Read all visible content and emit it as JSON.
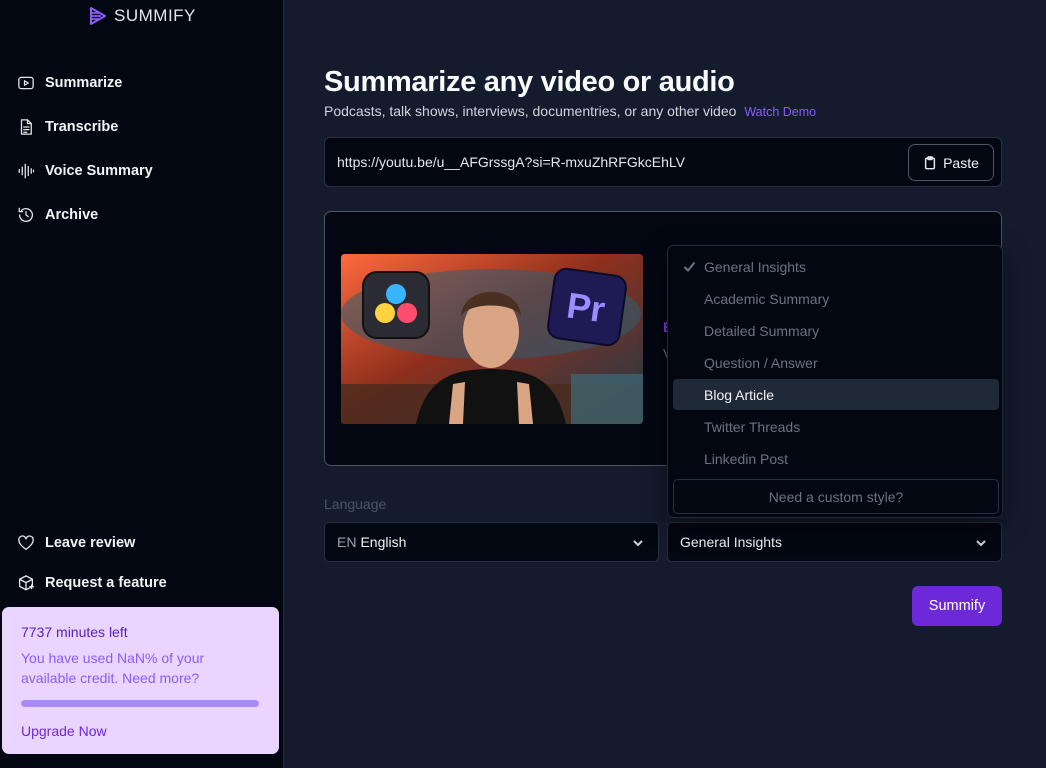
{
  "brand": {
    "name": "SUMMIFY",
    "accent": "#7c3aed"
  },
  "sidebar": {
    "nav": [
      {
        "label": "Summarize",
        "icon": "video-play-icon"
      },
      {
        "label": "Transcribe",
        "icon": "document-icon"
      },
      {
        "label": "Voice Summary",
        "icon": "waveform-icon"
      },
      {
        "label": "Archive",
        "icon": "history-icon"
      }
    ],
    "bottom": [
      {
        "label": "Leave review",
        "icon": "heart-icon"
      },
      {
        "label": "Request a feature",
        "icon": "package-icon"
      }
    ],
    "credit": {
      "minutes_left": "7737 minutes left",
      "text": "You have used NaN% of your available credit. Need more?",
      "upgrade": "Upgrade Now",
      "progress_fraction": 1.0
    }
  },
  "main": {
    "title": "Summarize any video or audio",
    "subtitle": "Podcasts, talk shows, interviews, documentries, or any other video",
    "watch_demo": "Watch Demo",
    "url_value": "https://youtu.be/u__AFGrssgA?si=R-mxuZhRFGkcEhLV",
    "paste_label": "Paste",
    "language_label": "Language",
    "language_code": "EN",
    "language_name": "English",
    "style_selected": "General Insights",
    "summify_label": "Summify",
    "thumb_icons": {
      "left": "davinci-resolve-icon",
      "right": "premiere-pro-icon",
      "right_text": "Pr"
    }
  },
  "dropdown": {
    "options": [
      {
        "label": "General Insights",
        "checked": true
      },
      {
        "label": "Academic Summary"
      },
      {
        "label": "Detailed Summary"
      },
      {
        "label": "Question / Answer"
      },
      {
        "label": "Blog Article",
        "highlighted": true
      },
      {
        "label": "Twitter Threads"
      },
      {
        "label": "Linkedin Post"
      }
    ],
    "custom_label": "Need a custom style?"
  }
}
